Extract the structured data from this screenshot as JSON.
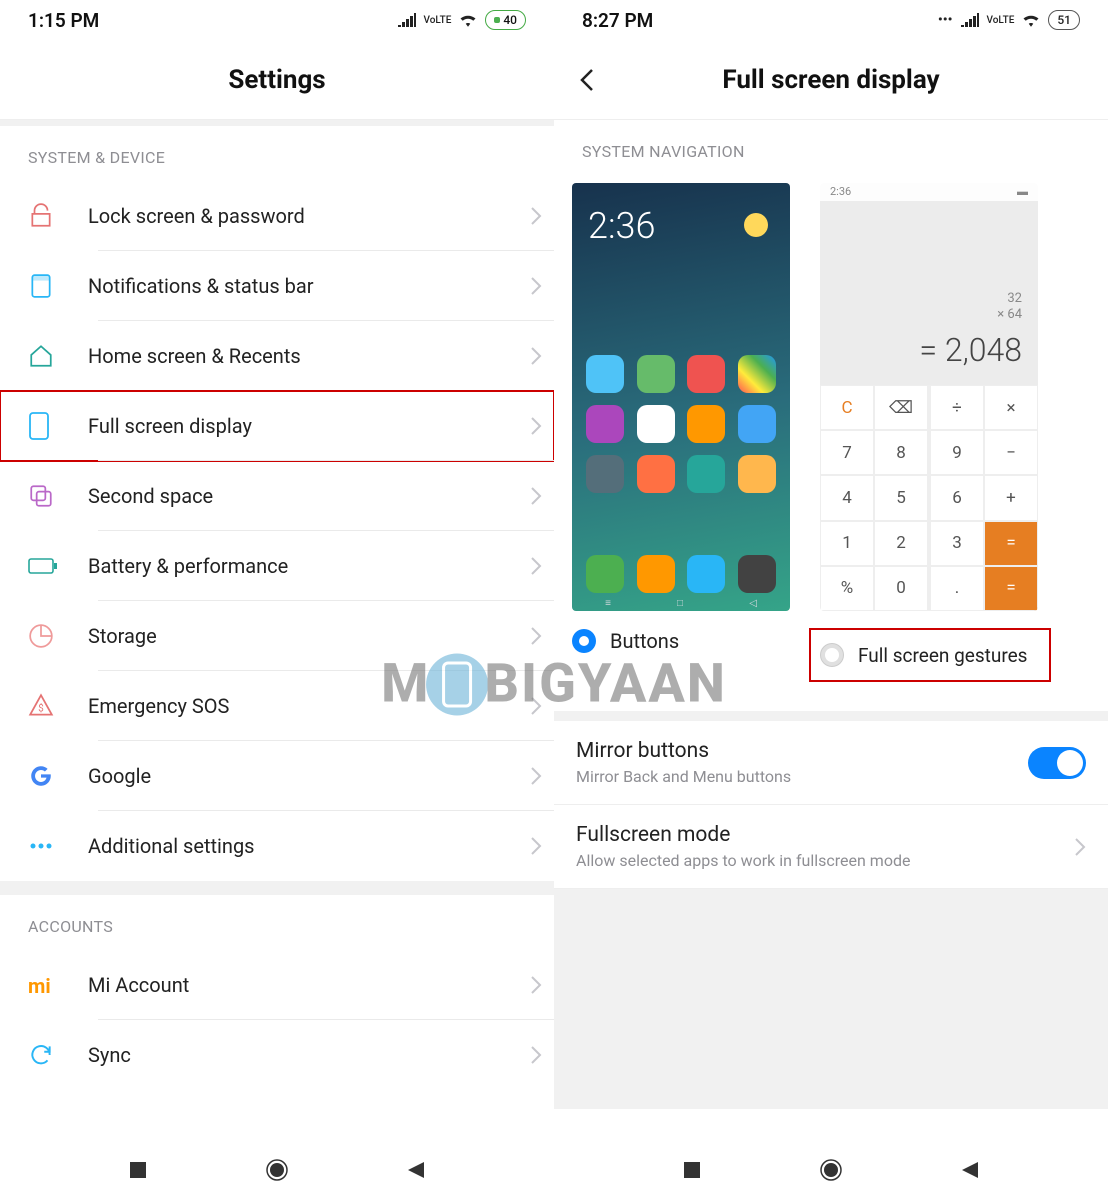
{
  "left": {
    "status": {
      "time": "1:15 PM",
      "volte": "VoLTE",
      "battery": "40"
    },
    "title": "Settings",
    "sections": {
      "system_header": "SYSTEM & DEVICE",
      "accounts_header": "ACCOUNTS"
    },
    "items": {
      "lock": "Lock screen & password",
      "notif": "Notifications & status bar",
      "home": "Home screen & Recents",
      "fsd": "Full screen display",
      "second": "Second space",
      "battery": "Battery & performance",
      "storage": "Storage",
      "sos": "Emergency SOS",
      "google": "Google",
      "more": "Additional settings",
      "mi": "Mi Account",
      "sync": "Sync"
    }
  },
  "right": {
    "status": {
      "time": "8:27 PM",
      "volte": "VoLTE",
      "battery": "51"
    },
    "title": "Full screen display",
    "nav_header": "SYSTEM NAVIGATION",
    "preview_home_time": "2:36",
    "calc": {
      "time": "2:36",
      "l1": "32",
      "l2": "× 64",
      "res": "= 2,048"
    },
    "keys": [
      "C",
      "⌫",
      "÷",
      "×",
      " ",
      "7",
      "8",
      "9",
      "−",
      " ",
      "4",
      "5",
      "6",
      "+",
      " ",
      "1",
      "2",
      "3",
      "=",
      " ",
      "%",
      "0",
      ".",
      "=",
      " "
    ],
    "opt_buttons": "Buttons",
    "opt_gestures": "Full screen gestures",
    "mirror_title": "Mirror buttons",
    "mirror_sub": "Mirror Back and Menu buttons",
    "fs_title": "Fullscreen mode",
    "fs_sub": "Allow selected apps to work in fullscreen mode"
  },
  "watermark": {
    "pre": "M",
    "post": "BIGYAAN"
  }
}
